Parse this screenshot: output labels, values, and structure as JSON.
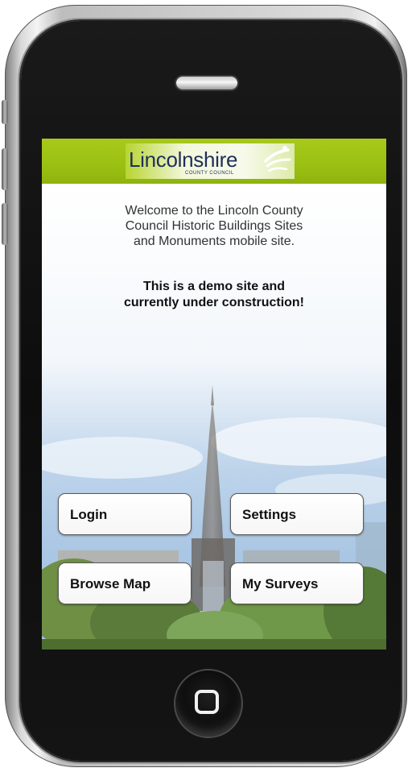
{
  "logo": {
    "title": "Lincolnshire",
    "subtitle": "COUNTY COUNCIL"
  },
  "welcome": {
    "line1": "Welcome to the Lincoln County",
    "line2": "Council Historic Buildings Sites",
    "line3": "and Monuments mobile site."
  },
  "notice": {
    "line1": "This is a demo site and",
    "line2": "currently under construction!"
  },
  "buttons": {
    "login": "Login",
    "settings": "Settings",
    "browse_map": "Browse Map",
    "my_surveys": "My Surveys"
  },
  "colors": {
    "header_green": "#9bc013",
    "logo_navy": "#1f2f5c"
  },
  "icons": {
    "home": "home-button-icon",
    "speaker": "speaker-icon"
  }
}
